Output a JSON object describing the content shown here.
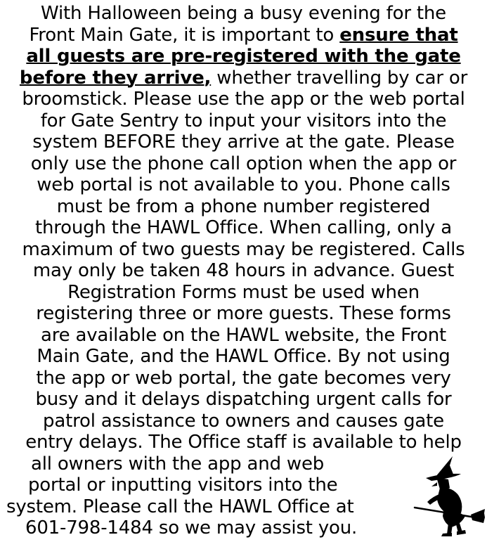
{
  "notice": {
    "line_01_a": "With Halloween being a busy evening for the",
    "line_02_a": "Front Main Gate, it is important to ",
    "line_02_emph": "ensure that",
    "line_03_emph": "all guests are pre-registered with the gate",
    "line_04_emph": "before they arrive,",
    "line_04_b": " whether travelling by car or",
    "line_05": "broomstick. Please use the app or the web portal",
    "line_06": "for Gate Sentry to input your visitors into the",
    "line_07": "system BEFORE they arrive at the gate. Please",
    "line_08": "only use the phone call option when the app or",
    "line_09": "web portal is not available to you. Phone calls",
    "line_10": "must be from a phone number registered",
    "line_11": "through the HAWL Office. When calling, only a",
    "line_12": "maximum of two guests may be registered. Calls",
    "line_13": "may only be taken 48 hours in advance. Guest",
    "line_14": "Registration Forms must be used when",
    "line_15": "registering three or more guests. These forms",
    "line_16": "are available on the HAWL website, the Front",
    "line_17": "Main Gate, and the HAWL Office. By not using",
    "line_18": "the app or web portal, the gate becomes very",
    "line_19": "busy and it delays dispatching urgent calls for",
    "line_20": "patrol assistance to owners and causes gate",
    "line_21": "entry delays. The Office staff is available to help",
    "line_22": "all owners with the app and web",
    "line_23": "portal or inputting visitors into the",
    "line_24": "system. Please call the HAWL Office at",
    "line_25": "601-798-1484 so we may assist you."
  },
  "graphic": {
    "icon": "witch-on-broomstick-icon",
    "color": "#000000"
  }
}
